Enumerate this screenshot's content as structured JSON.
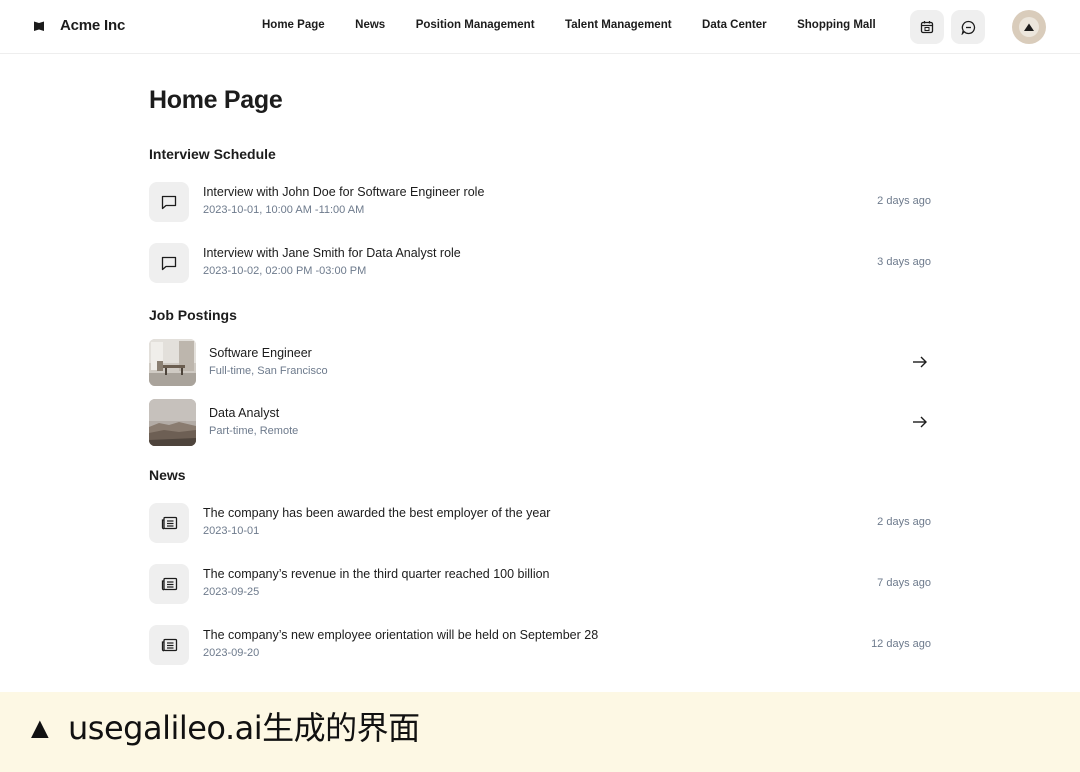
{
  "header": {
    "brand": "Acme Inc",
    "nav": [
      "Home Page",
      "News",
      "Position Management",
      "Talent Management",
      "Data Center",
      "Shopping Mall"
    ],
    "calendar_icon": "calendar-icon",
    "chat_icon": "chat-icon",
    "avatar_icon": "mountain-avatar-icon"
  },
  "main": {
    "title": "Home Page",
    "interviews": {
      "title": "Interview Schedule",
      "items": [
        {
          "title": "Interview with John Doe for Software Engineer role",
          "time": "2023-10-01, 10:00 AM -11:00 AM",
          "ago": "2 days ago"
        },
        {
          "title": "Interview with Jane Smith for Data Analyst role",
          "time": "2023-10-02, 02:00 PM -03:00 PM",
          "ago": "3 days ago"
        }
      ]
    },
    "jobs": {
      "title": "Job Postings",
      "items": [
        {
          "title": "Software Engineer",
          "detail": "Full-time, San Francisco"
        },
        {
          "title": "Data Analyst",
          "detail": "Part-time, Remote"
        }
      ]
    },
    "news": {
      "title": "News",
      "items": [
        {
          "title": "The company has been awarded the best employer of the year",
          "date": "2023-10-01",
          "ago": "2 days ago"
        },
        {
          "title": "The company’s revenue in the third quarter reached 100 billion",
          "date": "2023-09-25",
          "ago": "7 days ago"
        },
        {
          "title": "The company’s new employee orientation will be held on September 28",
          "date": "2023-09-20",
          "ago": "12 days ago"
        }
      ]
    }
  },
  "caption": {
    "marker": "▲",
    "text": "usegalileo.ai生成的界面"
  },
  "colors": {
    "icon_bg": "#efefef",
    "muted_text": "#6d7a8c",
    "caption_bg": "#fdf8e4"
  }
}
